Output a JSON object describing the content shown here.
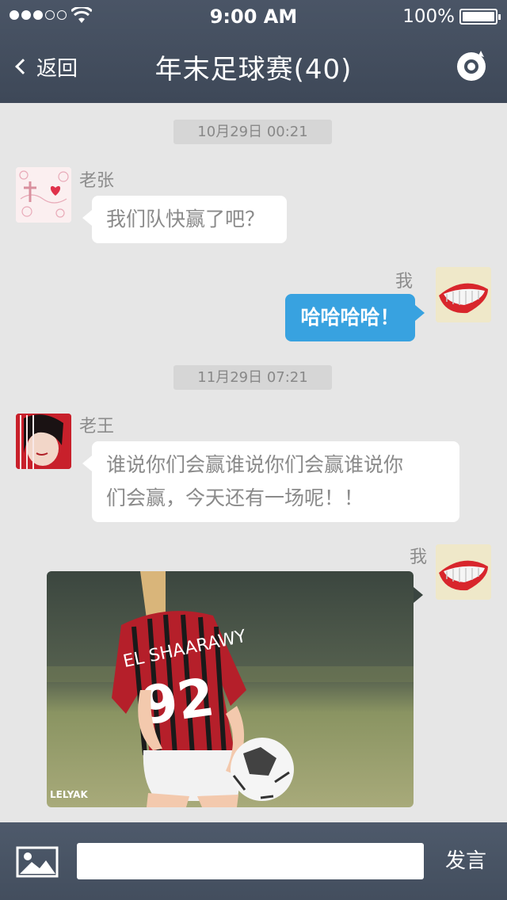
{
  "status_bar": {
    "time": "9:00 AM",
    "battery": "100%"
  },
  "nav": {
    "back_label": "返回",
    "title": "年末足球赛(40)",
    "action_icon": "camera-icon"
  },
  "messages": [
    {
      "type": "timestamp",
      "text": "10月29日 00:21"
    },
    {
      "type": "incoming",
      "sender": "老张",
      "text": "我们队快赢了吧？"
    },
    {
      "type": "outgoing",
      "sender": "我",
      "text": "哈哈哈哈！"
    },
    {
      "type": "timestamp",
      "text": "11月29日 07:21"
    },
    {
      "type": "incoming",
      "sender": "老王",
      "lines": [
        "谁说你们会赢谁说你们会赢谁说你",
        "们会赢，今天还有一场呢！！"
      ]
    },
    {
      "type": "outgoing-image",
      "sender": "我",
      "image_text": {
        "shirt_name": "EL SHAARAWY",
        "shirt_number": "92",
        "watermark": "LELYAK"
      }
    }
  ],
  "composer": {
    "image_icon": "image-icon",
    "placeholder": "",
    "send_label": "发言"
  },
  "colors": {
    "nav_bg": "#434e5e",
    "accent_bubble": "#38a2e0",
    "background": "#e6e6e6"
  }
}
